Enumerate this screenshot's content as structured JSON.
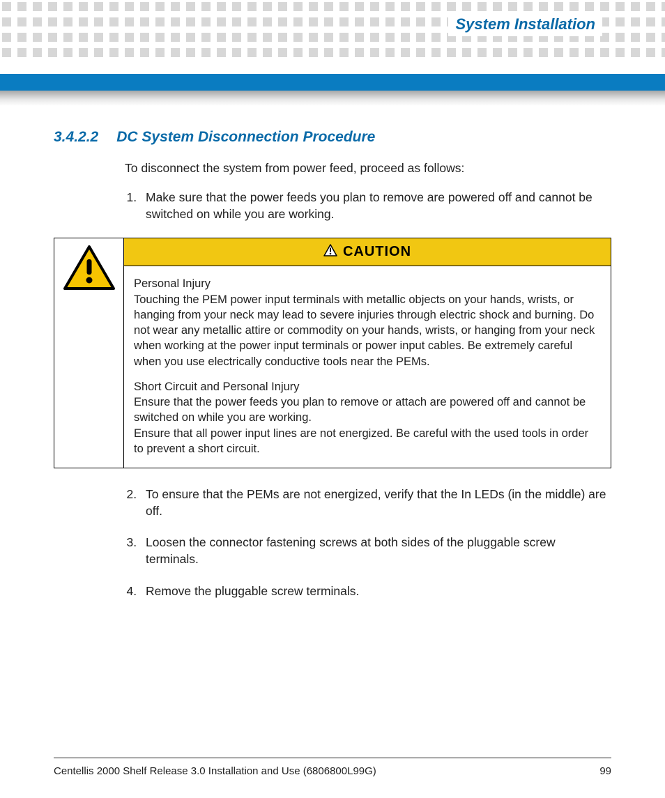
{
  "header": {
    "running_title": "System Installation"
  },
  "section": {
    "number": "3.4.2.2",
    "title": "DC System Disconnection Procedure",
    "intro": "To disconnect the system from power feed, proceed as follows:"
  },
  "steps": {
    "s1": "Make sure that the power feeds you plan to remove are powered off and cannot be switched on while you are working.",
    "s2": "To ensure that the PEMs are not energized, verify that the In LEDs (in the middle) are off.",
    "s3": "Loosen the connector fastening screws at both sides of the pluggable screw terminals.",
    "s4": "Remove the pluggable screw terminals."
  },
  "caution": {
    "label": "CAUTION",
    "p1_title": "Personal Injury",
    "p1_body": "Touching the PEM power input terminals with metallic objects on your hands, wrists, or hanging from your neck may lead to severe injuries through electric shock and burning. Do not wear any metallic attire or commodity on your hands, wrists, or hanging from your neck when working at the power input terminals or power input cables. Be extremely careful when you use electrically conductive tools near the PEMs.",
    "p2_title": "Short Circuit and Personal Injury",
    "p2_body_a": "Ensure that the power feeds you plan to remove or attach are powered off and cannot be switched on while you are working.",
    "p2_body_b": "Ensure that all power input lines are not energized. Be careful with the used tools in order to prevent a short circuit."
  },
  "footer": {
    "doc_title": "Centellis 2000 Shelf Release 3.0 Installation and Use (6806800L99G)",
    "page_number": "99"
  }
}
